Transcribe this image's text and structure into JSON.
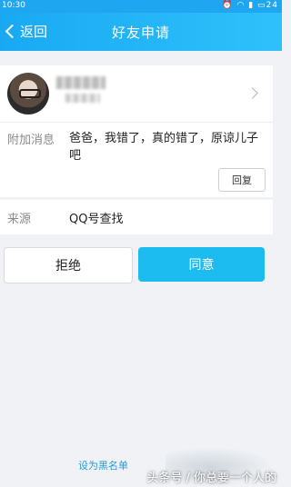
{
  "status_bar": {
    "time": "10:30",
    "battery": "24"
  },
  "header": {
    "back_label": "返回",
    "title": "好友申请"
  },
  "message": {
    "label": "附加消息",
    "text": "爸爸，我错了，真的错了，原谅儿子吧",
    "reply_label": "回复"
  },
  "source": {
    "label": "来源",
    "value": "QQ号查找"
  },
  "actions": {
    "reject_label": "拒绝",
    "accept_label": "同意"
  },
  "footer": {
    "blacklist_label": "设为黑名单",
    "watermark": "头条号 / 你总要一个人的"
  },
  "colors": {
    "accent": "#1dbcf0",
    "header_start": "#19a9f3",
    "header_end": "#2fc1fb",
    "link": "#1f9fd8"
  }
}
